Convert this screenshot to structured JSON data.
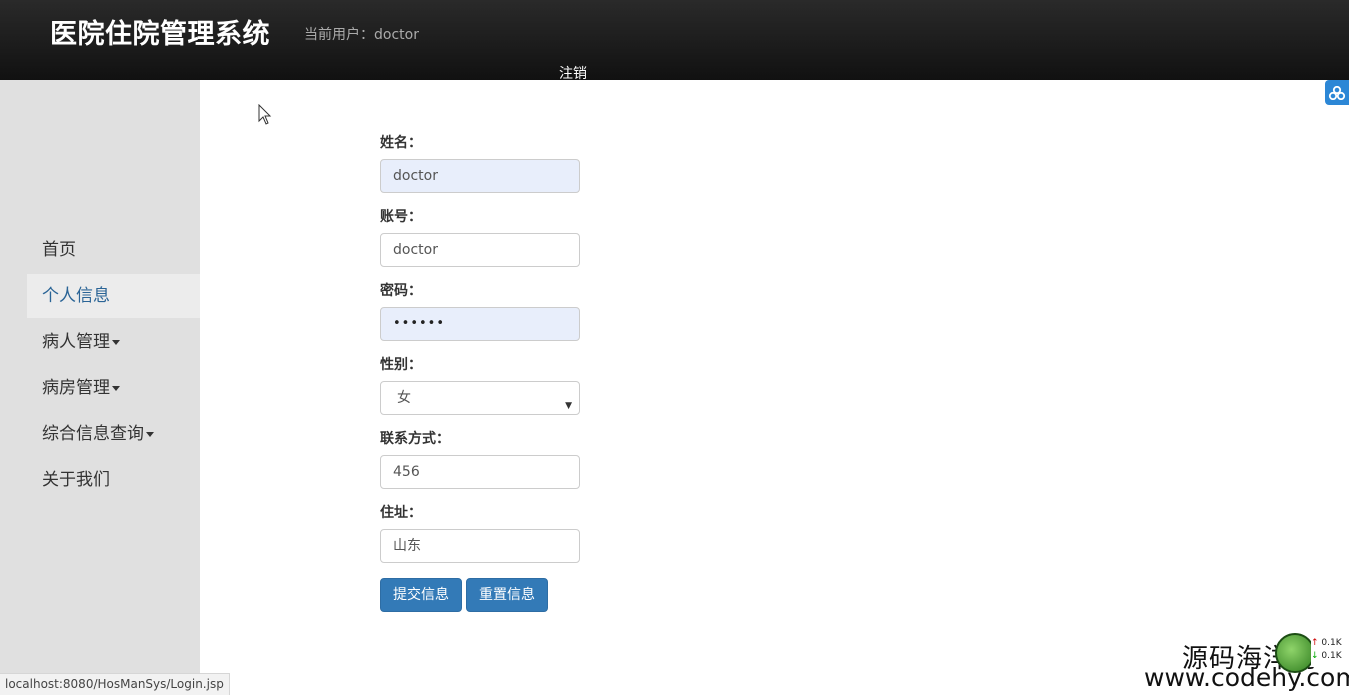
{
  "header": {
    "app_title": "医院住院管理系统",
    "current_user": "当前用户：doctor",
    "logout_label": "注销"
  },
  "sidebar": {
    "items": [
      {
        "label": "首页",
        "dropdown": false,
        "active": false
      },
      {
        "label": "个人信息",
        "dropdown": false,
        "active": true
      },
      {
        "label": "病人管理",
        "dropdown": true,
        "active": false
      },
      {
        "label": "病房管理",
        "dropdown": true,
        "active": false
      },
      {
        "label": "综合信息查询",
        "dropdown": true,
        "active": false
      },
      {
        "label": "关于我们",
        "dropdown": false,
        "active": false
      }
    ]
  },
  "form": {
    "name_label": "姓名：",
    "name_value": "doctor",
    "account_label": "账号：",
    "account_value": "doctor",
    "password_label": "密码：",
    "password_value": "••••••",
    "gender_label": "性别：",
    "gender_value": "女",
    "contact_label": "联系方式：",
    "contact_value": "456",
    "address_label": "住址：",
    "address_value": "山东",
    "submit_label": "提交信息",
    "reset_label": "重置信息"
  },
  "status_bar": {
    "url": "localhost:8080/HosManSys/Login.jsp"
  },
  "overlay": {
    "watermark_cn": "源码海洋网",
    "watermark_url": "www.codehy.com",
    "net_up": "0.1K",
    "net_down": "0.1K"
  },
  "colors": {
    "header_bg": "#1a1a1a",
    "sidebar_bg": "#e0e0e0",
    "primary": "#337ab7",
    "active_link": "#2a6496",
    "autofill_bg": "#e8eefb"
  }
}
